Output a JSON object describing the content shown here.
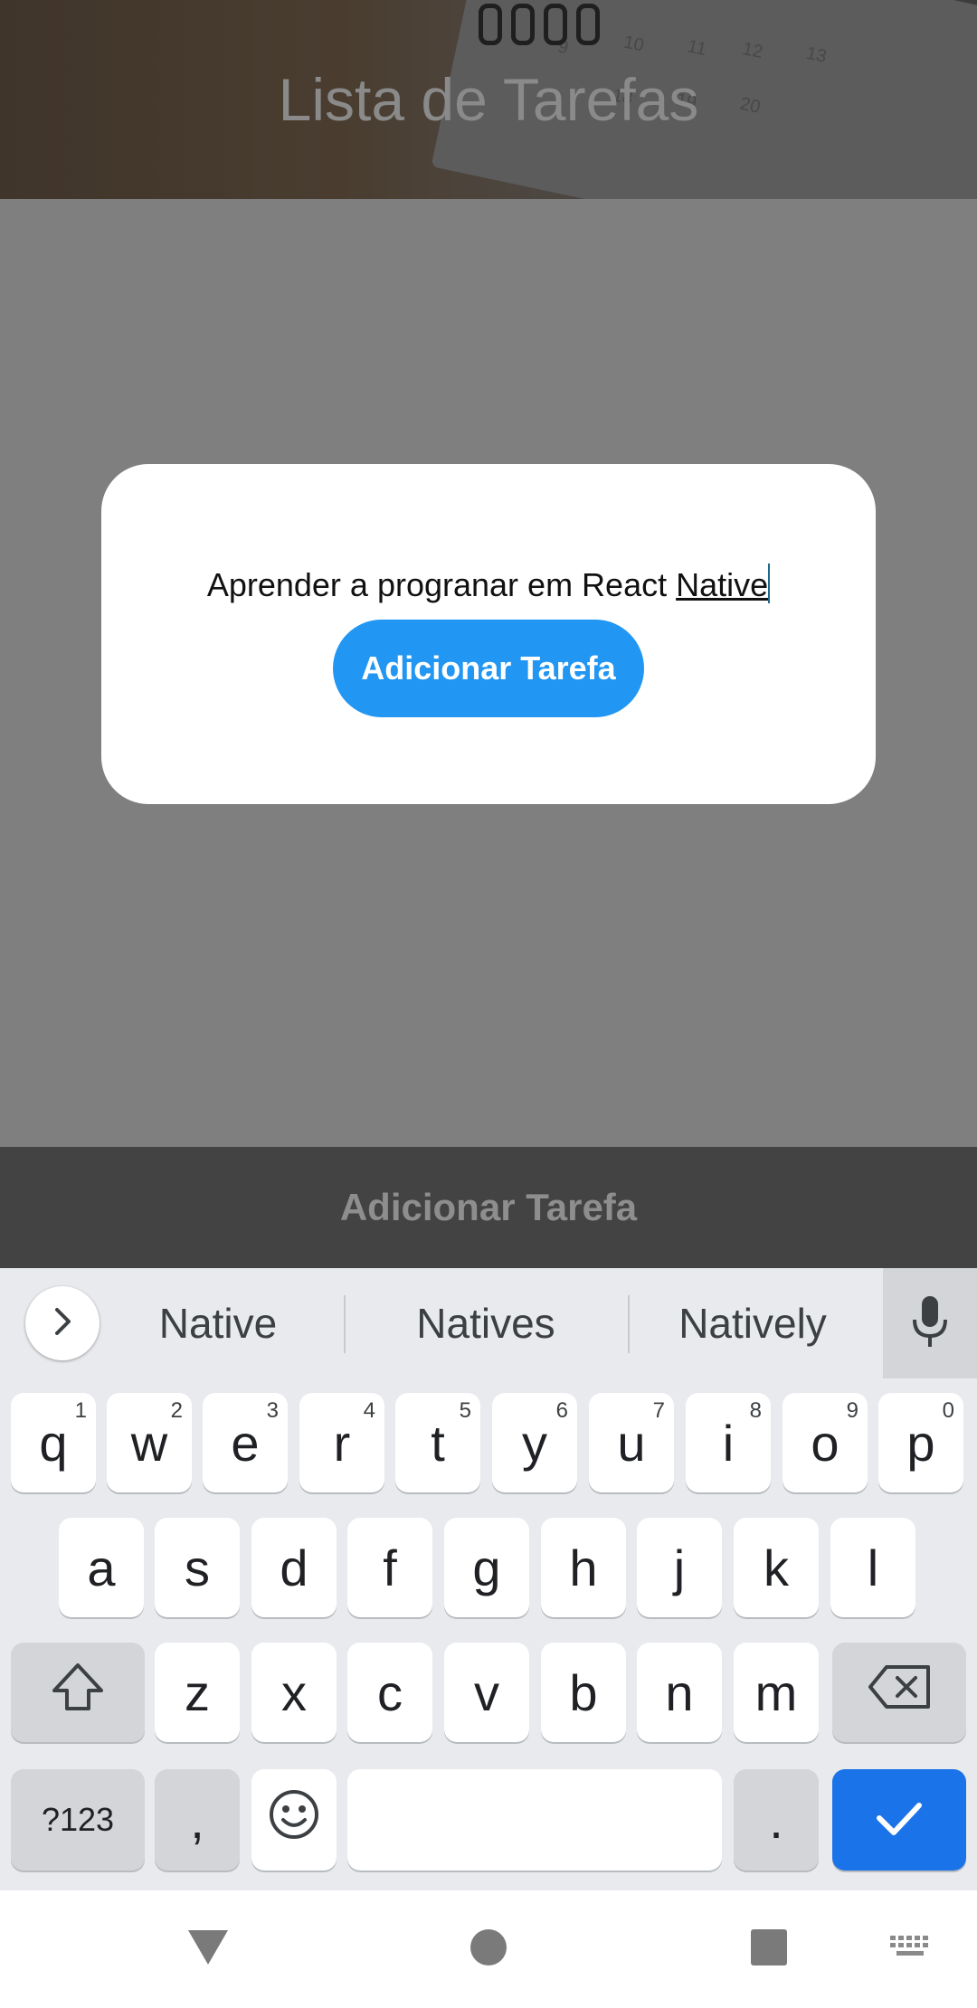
{
  "header": {
    "title": "Lista de Tarefas"
  },
  "modal": {
    "input_value_main": "Aprender a progranar em React ",
    "input_value_word": "Native",
    "button_label": "Adicionar Tarefa"
  },
  "bottom_bar": {
    "label": "Adicionar Tarefa"
  },
  "keyboard": {
    "suggestions": [
      "Native",
      "Natives",
      "Natively"
    ],
    "row1": [
      {
        "key": "q",
        "hint": "1"
      },
      {
        "key": "w",
        "hint": "2"
      },
      {
        "key": "e",
        "hint": "3"
      },
      {
        "key": "r",
        "hint": "4"
      },
      {
        "key": "t",
        "hint": "5"
      },
      {
        "key": "y",
        "hint": "6"
      },
      {
        "key": "u",
        "hint": "7"
      },
      {
        "key": "i",
        "hint": "8"
      },
      {
        "key": "o",
        "hint": "9"
      },
      {
        "key": "p",
        "hint": "0"
      }
    ],
    "row2": [
      "a",
      "s",
      "d",
      "f",
      "g",
      "h",
      "j",
      "k",
      "l"
    ],
    "row3": [
      "z",
      "x",
      "c",
      "v",
      "b",
      "n",
      "m"
    ],
    "symbols_label": "?123",
    "comma_label": ",",
    "period_label": ".",
    "icons": [
      "chevron-right-icon",
      "mic-icon",
      "shift-icon",
      "backspace-icon",
      "emoji-icon",
      "check-icon"
    ]
  },
  "navbar": {
    "icons": [
      "back-icon",
      "home-icon",
      "recents-icon",
      "keyboard-switch-icon"
    ]
  },
  "colors": {
    "accent": "#2196f3",
    "enter_key": "#1a73e8",
    "overlay": "#7f7f7f",
    "bottom_bar": "#434343"
  }
}
